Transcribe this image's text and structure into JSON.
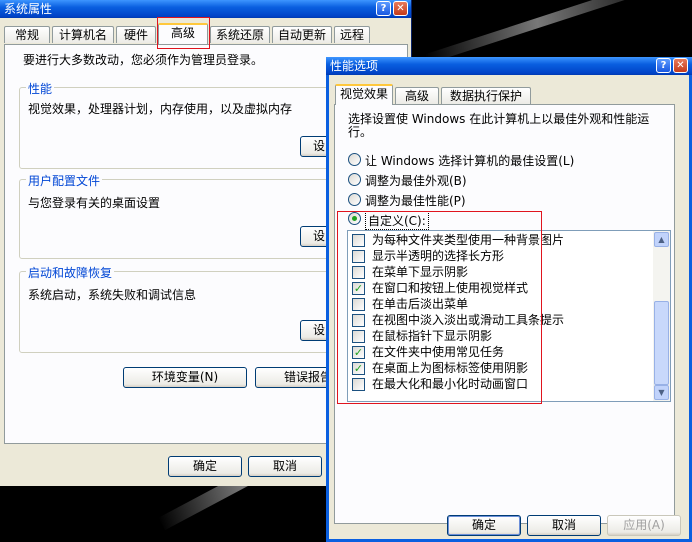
{
  "sysprops": {
    "title": "系统属性",
    "help_icon": "?",
    "close_icon": "✕",
    "tabs": [
      "常规",
      "计算机名",
      "硬件",
      "高级",
      "系统还原",
      "自动更新",
      "远程"
    ],
    "notice": "要进行大多数改动，您必须作为管理员登录。",
    "performance": {
      "label": "性能",
      "desc": "视觉效果，处理器计划，内存使用，以及虚拟内存",
      "button": "设"
    },
    "profiles": {
      "label": "用户配置文件",
      "desc": "与您登录有关的桌面设置",
      "button": "设"
    },
    "startup": {
      "label": "启动和故障恢复",
      "desc": "系统启动，系统失败和调试信息",
      "button": "设"
    },
    "env_button": "环境变量(N)",
    "error_button": "错误报告",
    "ok": "确定",
    "cancel": "取消"
  },
  "perfopts": {
    "title": "性能选项",
    "help_icon": "?",
    "close_icon": "✕",
    "tabs": [
      "视觉效果",
      "高级",
      "数据执行保护"
    ],
    "intro": "选择设置使 Windows 在此计算机上以最佳外观和性能运行。",
    "radios": [
      {
        "label": "让 Windows 选择计算机的最佳设置(L)",
        "checked": false
      },
      {
        "label": "调整为最佳外观(B)",
        "checked": false
      },
      {
        "label": "调整为最佳性能(P)",
        "checked": false
      },
      {
        "label": "自定义(C):",
        "checked": true
      }
    ],
    "options": [
      {
        "label": "为每种文件夹类型使用一种背景图片",
        "checked": false
      },
      {
        "label": "显示半透明的选择长方形",
        "checked": false
      },
      {
        "label": "在菜单下显示阴影",
        "checked": false
      },
      {
        "label": "在窗口和按钮上使用视觉样式",
        "checked": true
      },
      {
        "label": "在单击后淡出菜单",
        "checked": false
      },
      {
        "label": "在视图中淡入淡出或滑动工具条提示",
        "checked": false
      },
      {
        "label": "在鼠标指针下显示阴影",
        "checked": false
      },
      {
        "label": "在文件夹中使用常见任务",
        "checked": true
      },
      {
        "label": "在桌面上为图标标签使用阴影",
        "checked": true
      },
      {
        "label": "在最大化和最小化时动画窗口",
        "checked": false
      }
    ],
    "scroll_up": "▲",
    "scroll_down": "▼",
    "ok": "确定",
    "cancel": "取消",
    "apply": "应用(A)"
  },
  "colors": {
    "title_blue": "#0054e3",
    "highlight_red": "#e0141e",
    "check_green": "#21a121"
  }
}
